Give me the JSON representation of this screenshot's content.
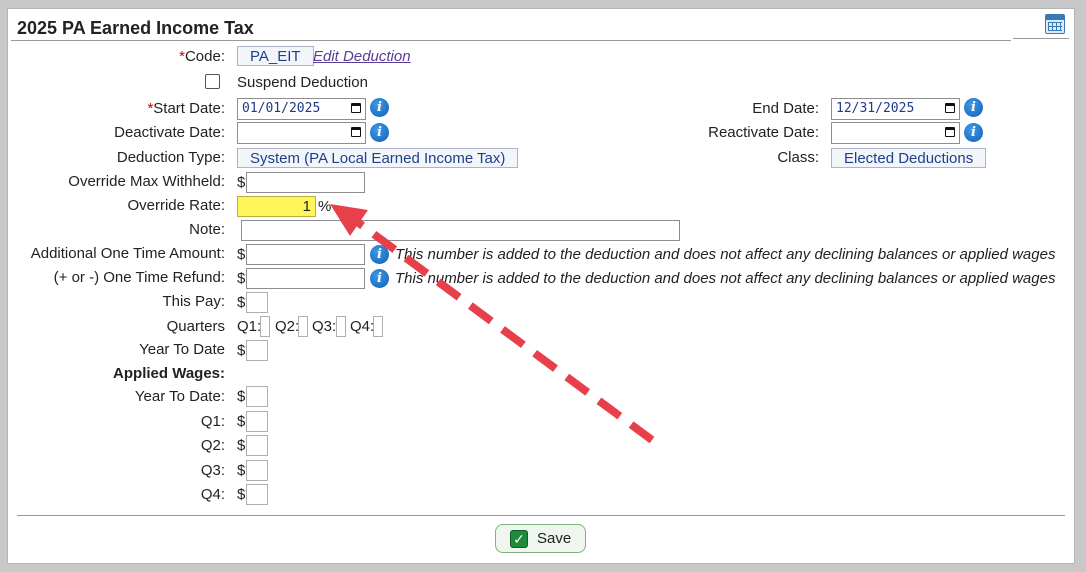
{
  "header": {
    "title": "2025 PA Earned Income Tax",
    "calendar_icon": "calendar-icon"
  },
  "fields": {
    "code_label": "Code:",
    "code_required": "*",
    "code_value": "PA_EIT",
    "edit_link": "Edit Deduction",
    "suspend_label": "Suspend Deduction",
    "suspend_checked": false,
    "start_date_label": "Start Date:",
    "start_date_required": "*",
    "start_date_value": "01/01/2025",
    "end_date_label": "End Date:",
    "end_date_value": "12/31/2025",
    "deactivate_label": "Deactivate Date:",
    "deactivate_value": "",
    "reactivate_label": "Reactivate Date:",
    "reactivate_value": "",
    "deduction_type_label": "Deduction Type:",
    "deduction_type_value": "System (PA Local Earned Income Tax)",
    "class_label": "Class:",
    "class_value": "Elected Deductions",
    "override_max_label": "Override Max Withheld:",
    "override_rate_label": "Override Rate:",
    "override_rate_value": "1",
    "percent_sign": "%",
    "note_label": "Note:",
    "additional_label": "Additional One Time Amount:",
    "refund_label": "(+ or -) One Time Refund:",
    "info_note": "This number is added to the deduction and does not affect any declining balances or applied wages",
    "this_pay_label": "This Pay:",
    "quarters_label": "Quarters",
    "q1_short": "Q1:",
    "q2_short": "Q2:",
    "q3_short": "Q3:",
    "q4_short": "Q4:",
    "ytd_label": "Year To Date",
    "applied_wages_label": "Applied Wages:",
    "aw_ytd_label": "Year To Date:",
    "aw_q1_label": "Q1:",
    "aw_q2_label": "Q2:",
    "aw_q3_label": "Q3:",
    "aw_q4_label": "Q4:",
    "dollar": "$",
    "info_glyph": "i"
  },
  "footer": {
    "save_label": "Save",
    "save_icon": "check-icon"
  },
  "colors": {
    "highlight": "#fff75a",
    "arrow": "#e8404a",
    "required": "#cc0000",
    "link": "#5a3b96"
  }
}
